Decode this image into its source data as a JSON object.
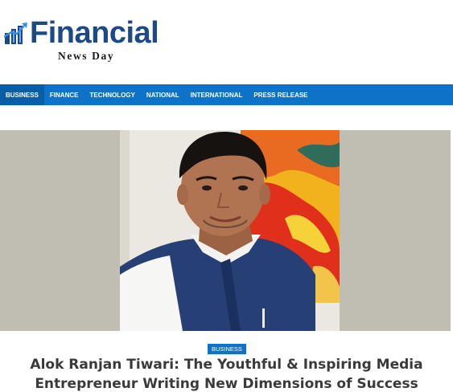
{
  "site": {
    "logo_word": "Financial",
    "logo_sub": "News Day",
    "brand_color": "#1d4a86"
  },
  "nav": {
    "color": "#0e73c6",
    "items": [
      {
        "label": "BUSINESS",
        "active": true
      },
      {
        "label": "FINANCE"
      },
      {
        "label": "TECHNOLOGY"
      },
      {
        "label": "NATIONAL"
      },
      {
        "label": "INTERNATIONAL"
      },
      {
        "label": "PRESS RELEASE"
      }
    ]
  },
  "article": {
    "category": "BUSINESS",
    "title": "Alok Ranjan Tiwari: The Youthful & Inspiring Media Entrepreneur Writing New Dimensions of Success"
  }
}
